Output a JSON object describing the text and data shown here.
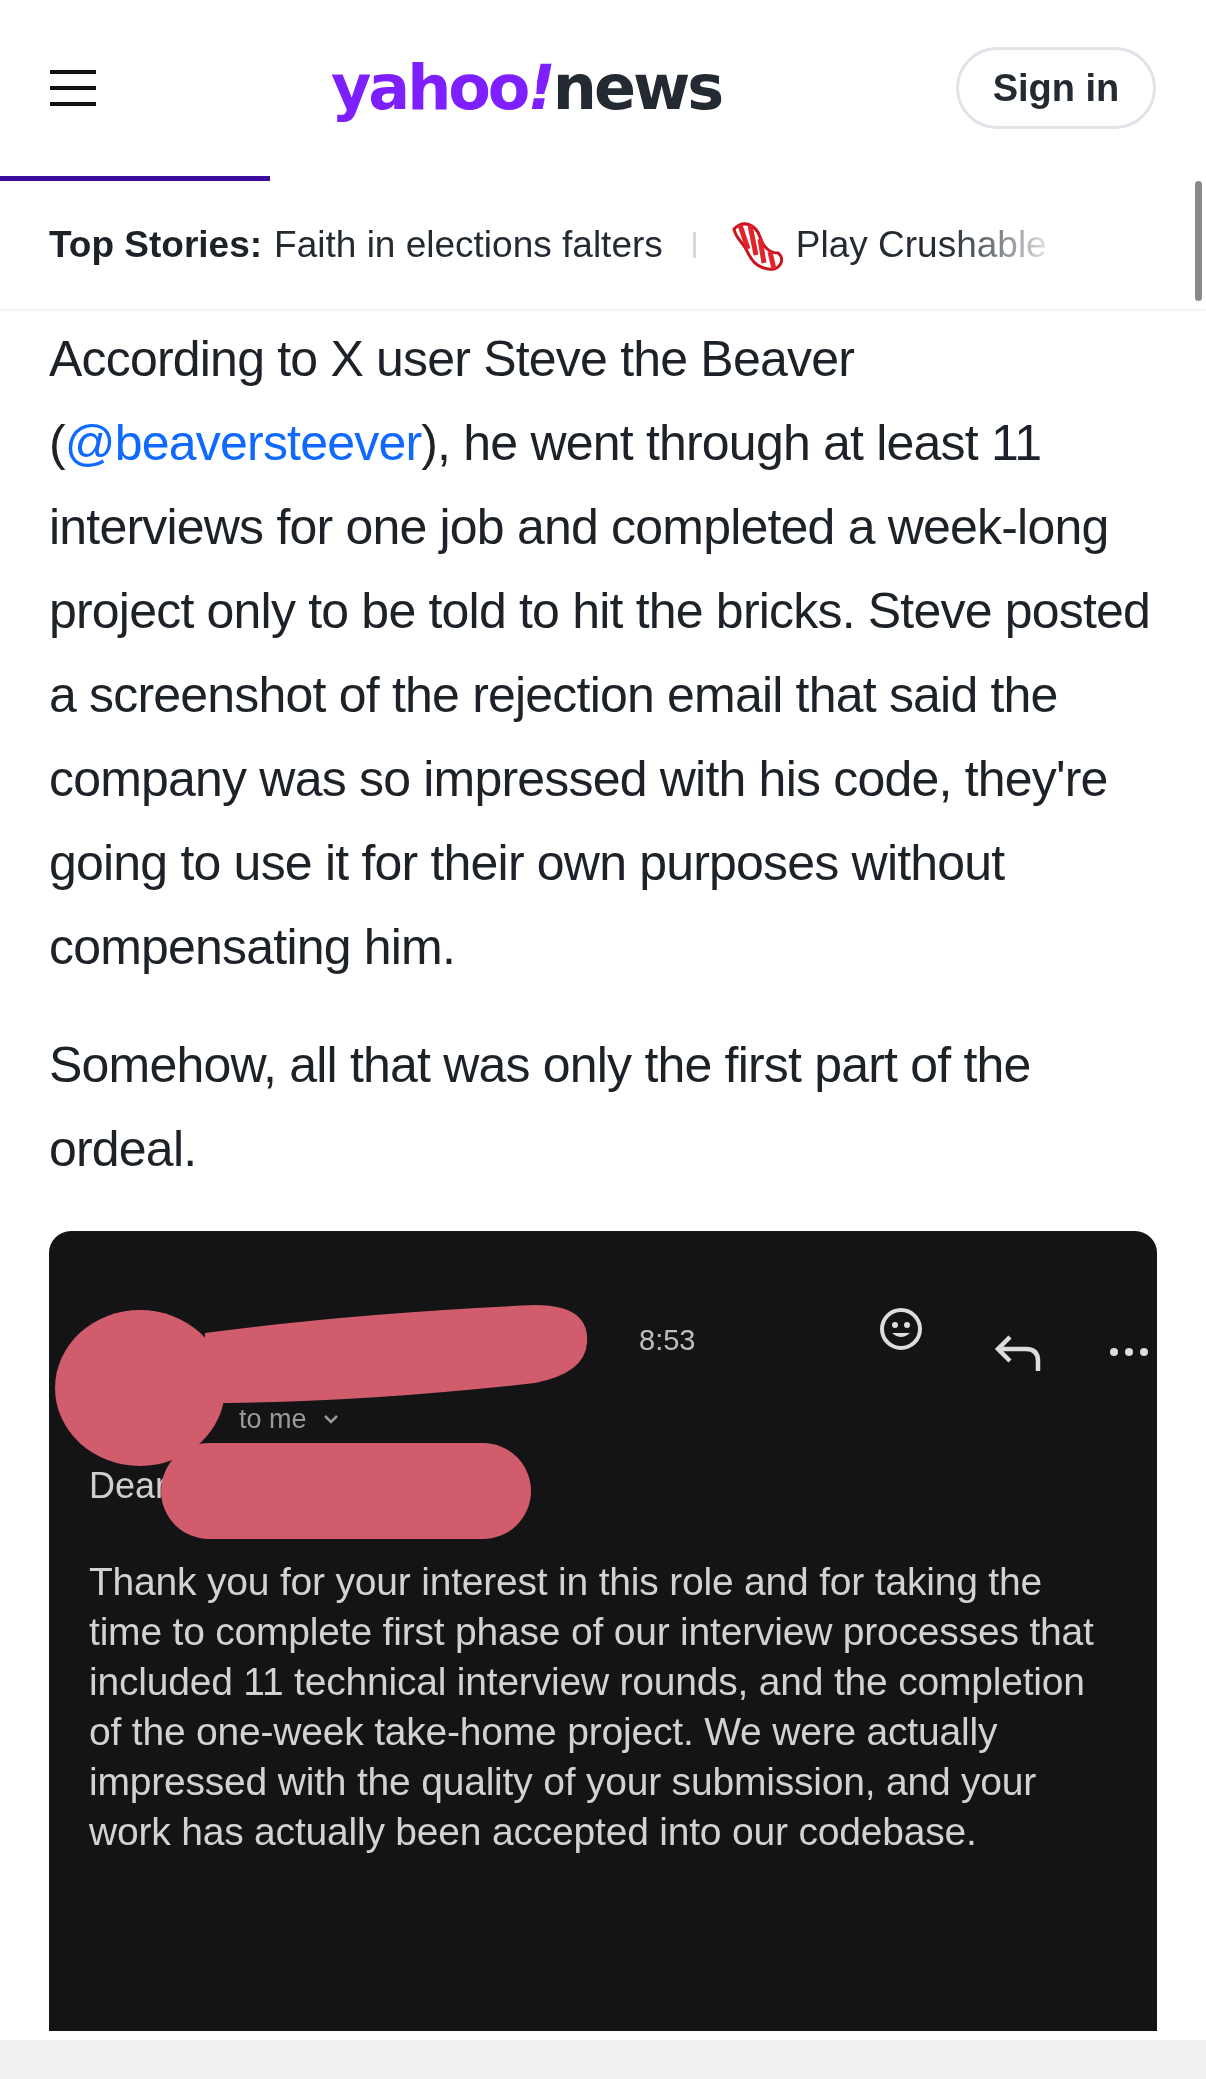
{
  "header": {
    "logo": {
      "brand": "yahoo",
      "mark": "!",
      "section": "news"
    },
    "sign_in": "Sign in"
  },
  "ticker": {
    "label": "Top Stories:",
    "story": "Faith in elections falters",
    "promo": "Play Crushable"
  },
  "article": {
    "paragraphs": [
      {
        "before": "According to X user Steve the Beaver (",
        "link": "@beaversteever",
        "after": "), he went through at least 11 interviews for one job and completed a week-long project only to be told to hit the bricks. Steve posted a screenshot of the rejection email that said the company was so impressed with his code, they're going to use it for their own purposes without compensating him."
      },
      {
        "before": "Somehow, all that was only the first part of the ordeal."
      }
    ]
  },
  "email_screenshot": {
    "time": "8:53",
    "recipient": "to me",
    "greeting": "Dear",
    "body": "Thank you for your interest in this role and for taking the time to complete first phase of our interview processes that included 11 technical interview rounds, and the completion of the one-week take-home project. We were actually impressed with the quality of your submission, and your work has actually been accepted into our codebase."
  }
}
